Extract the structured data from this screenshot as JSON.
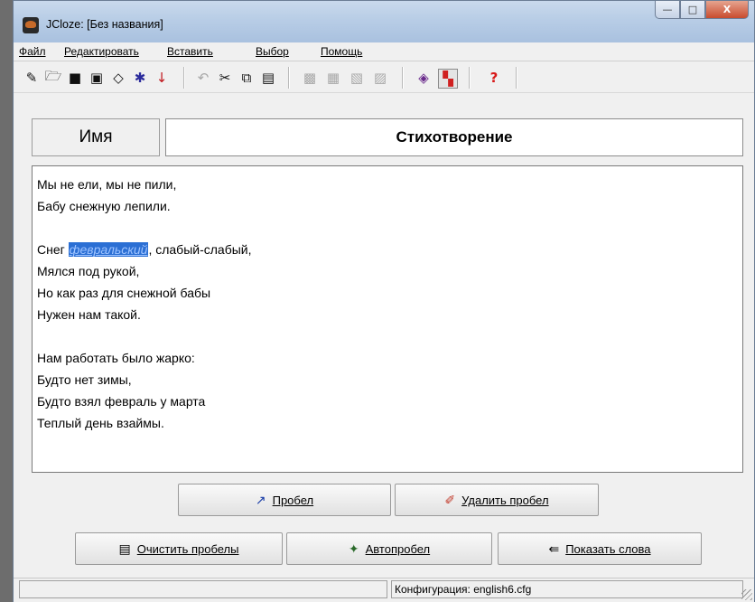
{
  "window": {
    "title": "JCloze: [Без названия]",
    "buttons": {
      "minimize": "—",
      "maximize": "□",
      "close": "X"
    }
  },
  "menu": [
    "Файл",
    "Редактировать",
    "Вставить",
    "Выбор",
    "Помощь"
  ],
  "toolbar": {
    "icons": [
      "new-file-icon",
      "open-folder-icon",
      "save-icon",
      "save-as-icon",
      "eraser-icon",
      "network-icon",
      "export-arrow-icon",
      "undo-icon",
      "cut-icon",
      "copy-icon",
      "paste-icon",
      "gap-icon-1",
      "gap-icon-2",
      "gap-icon-3",
      "gap-icon-4",
      "html-export-icon",
      "palette-icon",
      "help-icon"
    ]
  },
  "name_label": "Имя",
  "title_value": "Стихотворение",
  "text": {
    "lines": [
      "Мы не ели, мы не пили,",
      "Бабу снежную лепили.",
      "",
      "",
      "Мялся под рукой,",
      "Но как раз для снежной бабы",
      "Нужен нам такой.",
      "",
      "Нам работать было жарко:",
      "Будто нет зимы,",
      "Будто взял февраль у марта",
      "Теплый день взаймы."
    ],
    "gap_line": {
      "before": "Снег ",
      "gap": "февральский",
      "after": ", слабый-слабый,"
    }
  },
  "buttons": {
    "gap": "Пробел",
    "delete_gap": "Удалить пробел",
    "clear_gaps": "Очистить пробелы",
    "auto_gap": "Автопробел",
    "show_words": "Показать слова"
  },
  "status": {
    "config": "Конфигурация: english6.cfg"
  }
}
